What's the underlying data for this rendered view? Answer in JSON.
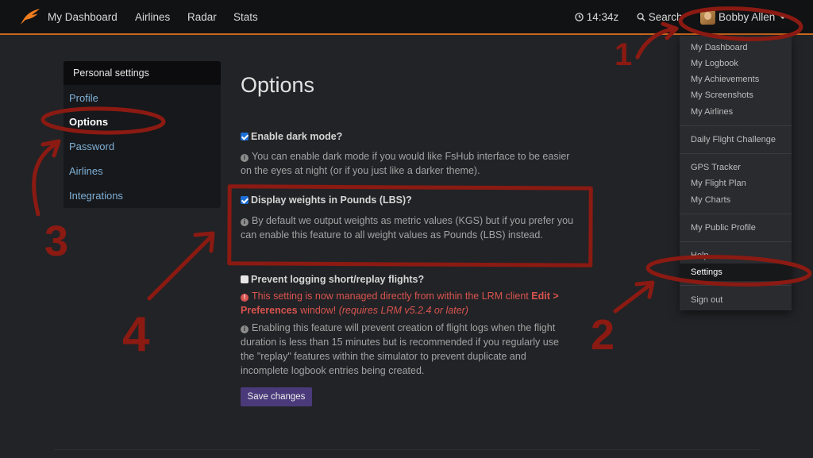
{
  "navbar": {
    "links": [
      "My Dashboard",
      "Airlines",
      "Radar",
      "Stats"
    ],
    "time": "14:34z",
    "search": "Search",
    "user": "Bobby Allen"
  },
  "dropdown": {
    "items": [
      "My Dashboard",
      "My Logbook",
      "My Achievements",
      "My Screenshots",
      "My Airlines",
      "Daily Flight Challenge",
      "GPS Tracker",
      "My Flight Plan",
      "My Charts",
      "My Public Profile",
      "Help",
      "Settings",
      "Sign out"
    ]
  },
  "sidebar": {
    "heading": "Personal settings",
    "items": [
      "Profile",
      "Options",
      "Password",
      "Airlines",
      "Integrations"
    ]
  },
  "page": {
    "title": "Options",
    "options": [
      {
        "label": "Enable dark mode?",
        "checked": true,
        "help": "You can enable dark mode if you would like FsHub interface to be easier on the eyes at night (or if you just like a darker theme)."
      },
      {
        "label": "Display weights in Pounds (LBS)?",
        "checked": true,
        "help": "By default we output weights as metric values (KGS) but if you prefer you can enable this feature to all weight values as Pounds (LBS) instead."
      },
      {
        "label": "Prevent logging short/replay flights?",
        "checked": false,
        "warning_prefix": "This setting is now managed directly from within the LRM client",
        "warning_bold": "Edit > Preferences",
        "warning_mid": "window!",
        "warning_italic": "(requires LRM v5.2.4 or later)",
        "help": "Enabling this feature will prevent creation of flight logs when the flight duration is less than 15 minutes but is recommended if you regularly use the \"replay\" features within the simulator to prevent duplicate and incomplete logbook entries being created."
      }
    ],
    "save_label": "Save changes"
  },
  "annotations": [
    "1",
    "2",
    "3",
    "4"
  ],
  "colors": {
    "accent": "#c9661c",
    "annotation": "#8b1a12",
    "link": "#7fb0d6",
    "warning": "#d9534f",
    "button": "#4a3a7a"
  }
}
